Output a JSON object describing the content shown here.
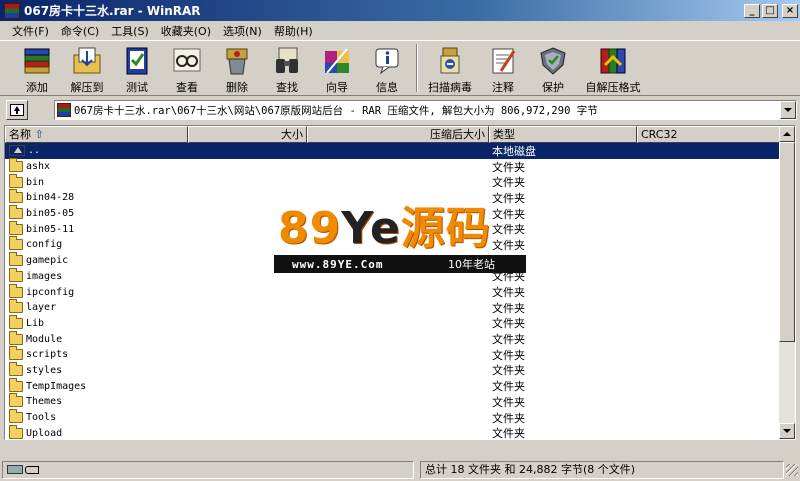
{
  "window": {
    "title": "067房卡十三水.rar - WinRAR",
    "buttons": [
      "_",
      "□",
      "×"
    ]
  },
  "menu": [
    "文件(F)",
    "命令(C)",
    "工具(S)",
    "收藏夹(O)",
    "选项(N)",
    "帮助(H)"
  ],
  "toolbar": {
    "add": "添加",
    "extract": "解压到",
    "test": "测试",
    "view": "查看",
    "delete": "删除",
    "find": "查找",
    "wizard": "向导",
    "info": "信息",
    "virus": "扫描病毒",
    "comment": "注释",
    "protect": "保护",
    "sfx": "自解压格式"
  },
  "address": {
    "path": "067房卡十三水.rar\\067十三水\\网站\\067原版网站后台 - RAR 压缩文件, 解包大小为 806,972,290 字节"
  },
  "columns": {
    "name": "名称",
    "size": "大小",
    "packed": "压缩后大小",
    "type": "类型",
    "crc": "CRC32"
  },
  "rows": [
    {
      "name": "..",
      "type": "本地磁盘",
      "selected": true,
      "kind": "up"
    },
    {
      "name": "ashx",
      "type": "文件夹"
    },
    {
      "name": "bin",
      "type": "文件夹"
    },
    {
      "name": "bin04-28",
      "type": "文件夹"
    },
    {
      "name": "bin05-05",
      "type": "文件夹"
    },
    {
      "name": "bin05-11",
      "type": "文件夹"
    },
    {
      "name": "config",
      "type": "文件夹"
    },
    {
      "name": "gamepic",
      "type": "文件夹"
    },
    {
      "name": "images",
      "type": "文件夹"
    },
    {
      "name": "ipconfig",
      "type": "文件夹"
    },
    {
      "name": "layer",
      "type": "文件夹"
    },
    {
      "name": "Lib",
      "type": "文件夹"
    },
    {
      "name": "Module",
      "type": "文件夹"
    },
    {
      "name": "scripts",
      "type": "文件夹"
    },
    {
      "name": "styles",
      "type": "文件夹"
    },
    {
      "name": "TempImages",
      "type": "文件夹"
    },
    {
      "name": "Themes",
      "type": "文件夹"
    },
    {
      "name": "Tools",
      "type": "文件夹"
    },
    {
      "name": "Upload",
      "type": "文件夹"
    }
  ],
  "watermark": {
    "brand_num": "89",
    "brand_y": "Ye",
    "brand_cn": "源码",
    "url": "www.89YE.Com",
    "tag": "10年老站"
  },
  "status": {
    "summary": "总计 18 文件夹 和 24,882 字节(8 个文件)"
  }
}
